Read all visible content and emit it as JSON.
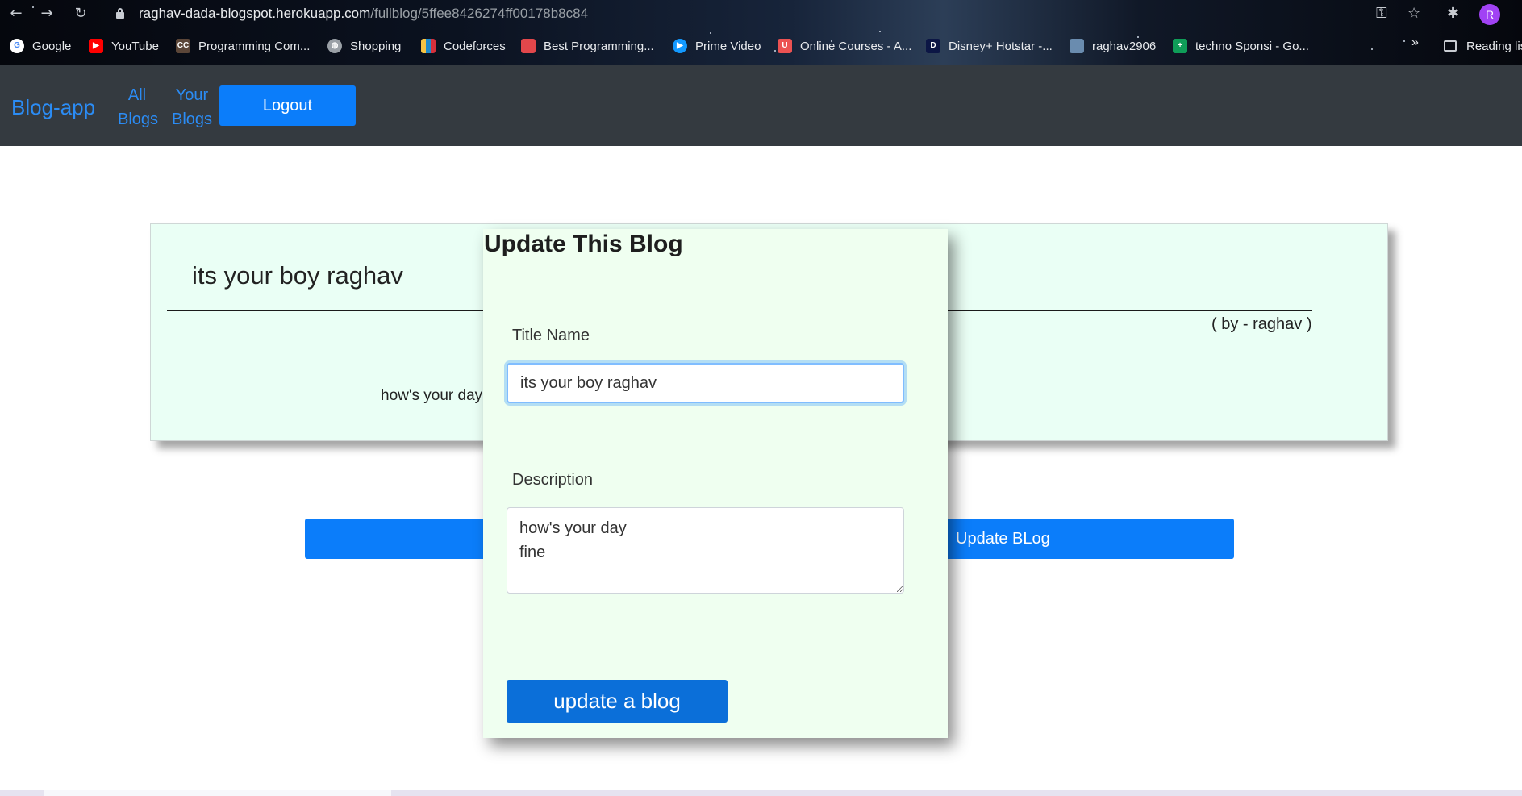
{
  "browser": {
    "url_host": "raghav-dada-blogspot.herokuapp.com",
    "url_path": "/fullblog/5ffee8426274ff00178b8c84",
    "nav_icons": [
      "back-icon",
      "forward-icon",
      "reload-icon"
    ],
    "right_icons": [
      "key-icon",
      "star-icon",
      "extensions-icon"
    ],
    "avatar_letter": "R",
    "bookmarks": [
      {
        "label": "Google",
        "icon": "google-icon",
        "color": "#ffffff"
      },
      {
        "label": "YouTube",
        "icon": "youtube-icon",
        "color": "#ff0000"
      },
      {
        "label": "Programming Com...",
        "icon": "codechef-icon",
        "color": "#5b4638"
      },
      {
        "label": "Shopping",
        "icon": "globe-icon",
        "color": "#9aa0a6"
      },
      {
        "label": "Codeforces",
        "icon": "codeforces-icon",
        "color": "#1f8acb"
      },
      {
        "label": "Best Programming...",
        "icon": "cube-icon",
        "color": "#e2474b"
      },
      {
        "label": "Prime Video",
        "icon": "prime-video-icon",
        "color": "#1399ff"
      },
      {
        "label": "Online Courses - A...",
        "icon": "udemy-icon",
        "color": "#ec5252"
      },
      {
        "label": "Disney+ Hotstar -...",
        "icon": "hotstar-icon",
        "color": "#0c1645"
      },
      {
        "label": "raghav2906",
        "icon": "profile-image-icon",
        "color": "#6a8caf"
      },
      {
        "label": "techno Sponsi - Go...",
        "icon": "google-sheets-icon",
        "color": "#0f9d58"
      }
    ],
    "overflow_label": "»",
    "reading_list_label": "Reading lis"
  },
  "navbar": {
    "brand": "Blog-app",
    "all_blogs_line1": "All",
    "all_blogs_line2": "Blogs",
    "your_blogs_line1": "Your",
    "your_blogs_line2": "Blogs",
    "logout": "Logout"
  },
  "blog": {
    "title": "its your boy raghav",
    "author": "( by - raghav )",
    "description_visible": "how's your day",
    "update_button": "Update BLog"
  },
  "modal": {
    "heading": "Update This Blog",
    "title_label": "Title Name",
    "title_value": "its your boy raghav",
    "description_label": "Description",
    "description_line1": "how's your day",
    "description_line2": "fine",
    "submit": "update a blog"
  },
  "colors": {
    "navbar_bg": "#343a40",
    "link_blue": "#2b8cf5",
    "button_blue": "#0b7dfa",
    "card_bg": "#eafff5",
    "modal_bg": "#effff0"
  }
}
